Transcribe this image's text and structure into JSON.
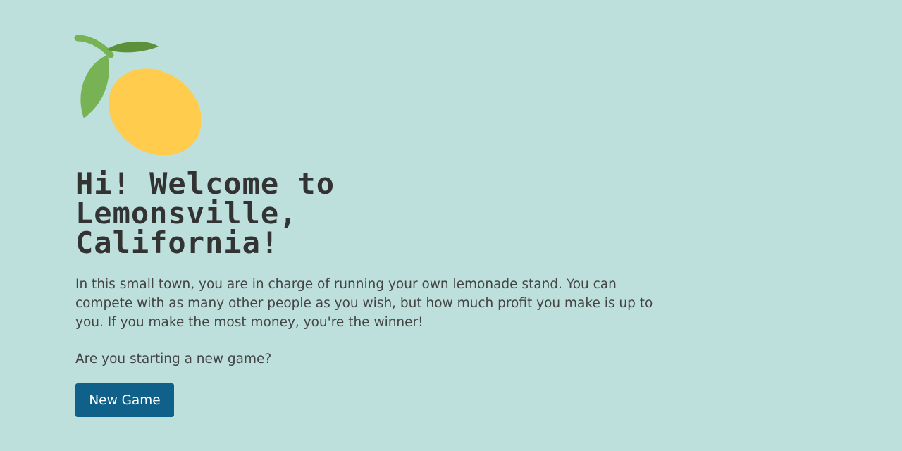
{
  "colors": {
    "background": "#bde0dd",
    "heading": "#333333",
    "body_text": "#444444",
    "button_bg": "#0f6189",
    "button_text": "#ffffff",
    "lemon": "#ffcc4d",
    "leaf": "#77b255"
  },
  "logo": {
    "icon": "lemon-icon"
  },
  "welcome": {
    "title": "Hi! Welcome to\nLemonsville,\nCalifornia!",
    "intro": "In this small town, you are in charge of running your own lemonade stand. You can compete with as many other people as you wish, but how much profit you make is up to you. If you make the most money, you're the winner!",
    "prompt": "Are you starting a new game?",
    "new_game_label": "New Game"
  }
}
